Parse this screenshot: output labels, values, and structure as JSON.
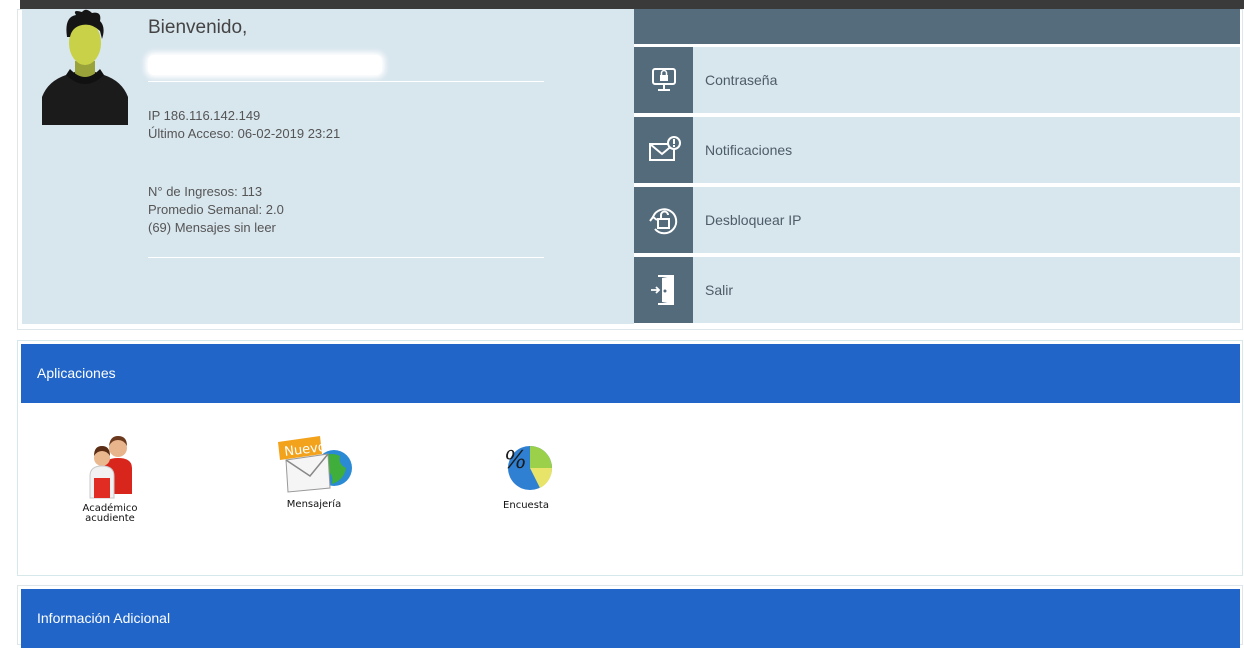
{
  "profile": {
    "welcome": "Bienvenido,",
    "ip": "IP 186.116.142.149",
    "last_access": "Último Acceso: 06-02-2019 23:21",
    "logins": "N° de Ingresos: 113",
    "weekly_avg": "Promedio Semanal: 2.0",
    "unread": "(69) Mensajes sin leer"
  },
  "menu": {
    "items": [
      {
        "label": "Contraseña",
        "icon": "monitor-lock-icon"
      },
      {
        "label": "Notificaciones",
        "icon": "envelope-alert-icon"
      },
      {
        "label": "Desbloquear IP",
        "icon": "unlock-refresh-icon"
      },
      {
        "label": "Salir",
        "icon": "exit-door-icon"
      }
    ]
  },
  "applications": {
    "title": "Aplicaciones",
    "items": [
      {
        "label_line1": "Académico",
        "label_line2": "acudiente",
        "icon": "academic-people-icon"
      },
      {
        "label_line1": "Mensajería",
        "badge": "Nuevo",
        "icon": "messaging-globe-icon"
      },
      {
        "label_line1": "Encuesta",
        "icon": "survey-percent-icon"
      }
    ]
  },
  "additional_info": {
    "title": "Información Adicional"
  },
  "colors": {
    "header_blue": "#2165c9",
    "panel_bg": "#d8e6ee",
    "icon_bg": "#546b7b"
  }
}
